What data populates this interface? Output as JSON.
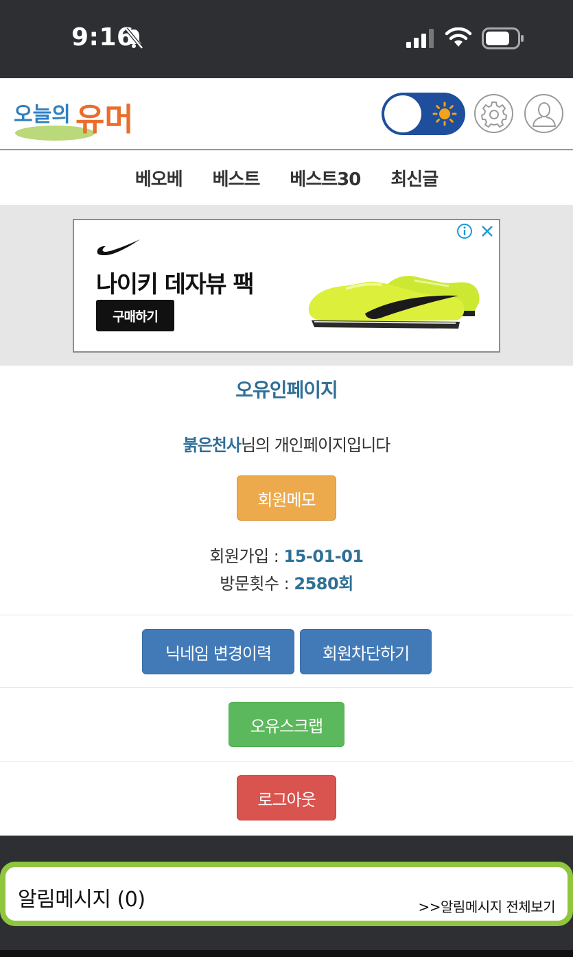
{
  "status_bar": {
    "time": "9:16"
  },
  "header": {
    "logo_alt": "오늘의유머",
    "logo_text_top": "오늘의",
    "logo_text_main": "유머",
    "theme_toggle_state": "light"
  },
  "nav": {
    "items": [
      {
        "label": "베오베"
      },
      {
        "label": "베스트"
      },
      {
        "label": "베스트30"
      },
      {
        "label": "최신글"
      }
    ]
  },
  "ad": {
    "title": "나이키 데자뷰 팩",
    "cta": "구매하기",
    "info_glyph": "i",
    "close_glyph": "✕"
  },
  "profile": {
    "page_title": "오유인페이지",
    "nickname": "붉은천사",
    "greeting_suffix": "님의 개인페이지입니다",
    "memo_button": "회원메모",
    "join_label": "회원가입 : ",
    "join_value": "15-01-01",
    "visit_label": "방문횟수 : ",
    "visit_value": "2580회",
    "history_button": "닉네임 변경이력",
    "block_button": "회원차단하기",
    "scrap_button": "오유스크랩",
    "logout_button": "로그아웃"
  },
  "notification": {
    "title": "알림메시지 (0)",
    "view_all": ">>알림메시지 전체보기"
  },
  "colors": {
    "accent_blue": "#2f6f96",
    "memo_orange": "#ecaa4d",
    "primary_blue": "#427ab8",
    "success_green": "#5cb85c",
    "danger_red": "#d9534f",
    "notif_border": "#8fc63e",
    "toggle_blue": "#1f4f9c"
  }
}
